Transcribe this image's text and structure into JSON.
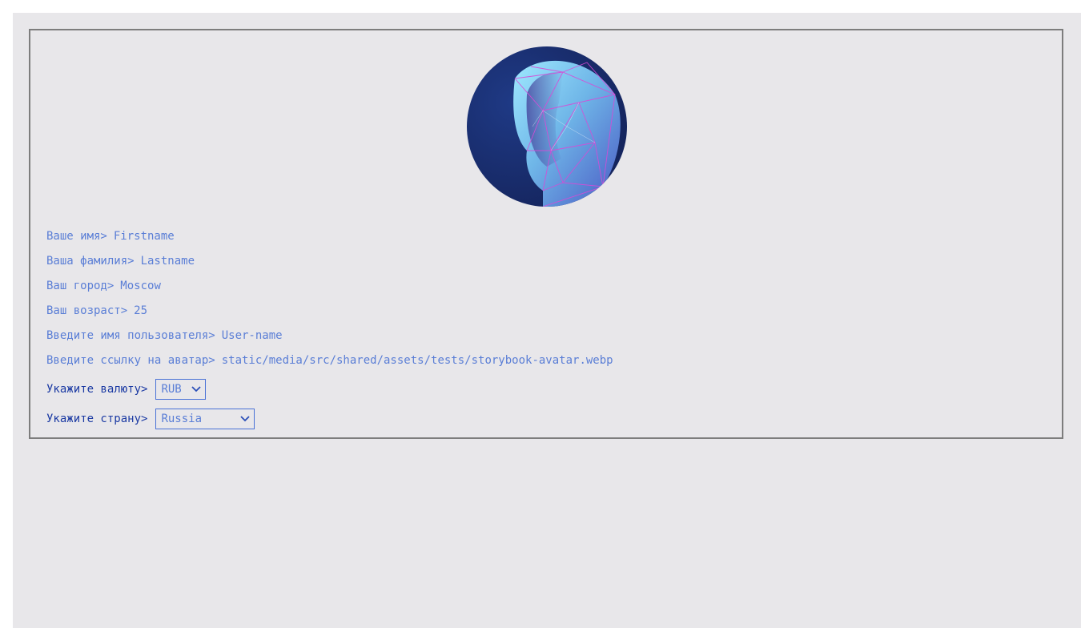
{
  "profile": {
    "firstname": {
      "label": "Ваше имя>",
      "value": "Firstname"
    },
    "lastname": {
      "label": "Ваша фамилия>",
      "value": "Lastname"
    },
    "city": {
      "label": "Ваш город>",
      "value": "Moscow"
    },
    "age": {
      "label": "Ваш возраст>",
      "value": "25"
    },
    "username": {
      "label": "Введите имя пользователя>",
      "value": "User-name"
    },
    "avatar": {
      "label": "Введите ссылку на аватар>",
      "value": "static/media/src/shared/assets/tests/storybook-avatar.webp"
    },
    "currency": {
      "label": "Укажите валюту>",
      "selected": "RUB"
    },
    "country": {
      "label": "Укажите страну>",
      "selected": "Russia"
    }
  },
  "icons": {
    "avatar_image": "avatar-image",
    "select_arrow": "chevron-down-icon"
  },
  "colors": {
    "background": "#e8e7ea",
    "border": "#7d7d7d",
    "text_readonly": "#5a7ed6",
    "text_label_select": "#1b3aa3",
    "select_border": "#4a72d6"
  }
}
